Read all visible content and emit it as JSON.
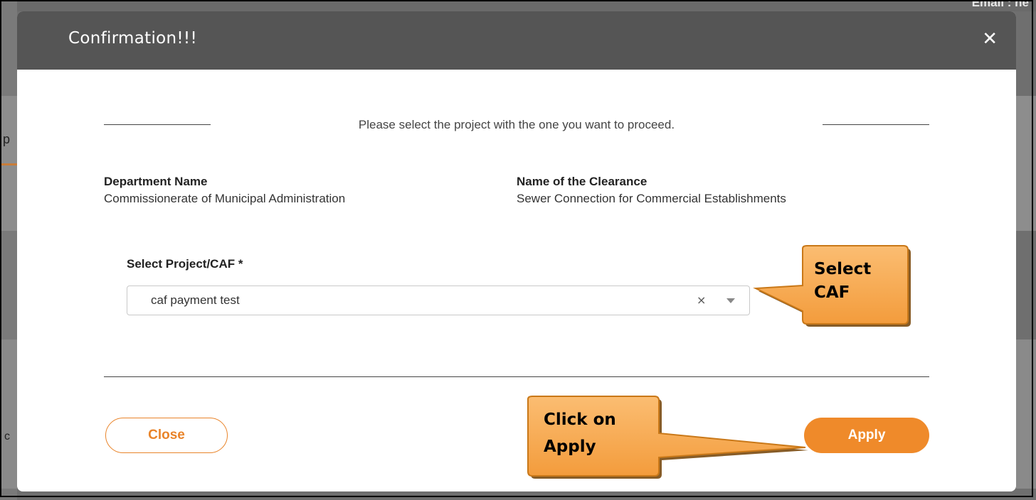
{
  "background": {
    "email_fragment": "Email : ne",
    "left_letter_top": "p",
    "left_letter_bottom": "c"
  },
  "modal": {
    "title": "Confirmation!!!",
    "close_icon": "close-icon",
    "instruction": "Please select the project with the one you want to proceed.",
    "department_label": "Department Name",
    "department_value": "Commissionerate of Municipal Administration",
    "clearance_label": "Name of the Clearance",
    "clearance_value": "Sewer Connection for Commercial Establishments",
    "select_label": "Select Project/CAF *",
    "select_value": "caf payment test",
    "select_clear": "×",
    "close_button": "Close",
    "apply_button": "Apply"
  },
  "annotations": {
    "select_caf_line1": "Select",
    "select_caf_line2": "CAF",
    "apply_line1": "Click on",
    "apply_line2": "Apply"
  },
  "colors": {
    "header": "#555555",
    "accent": "#ef8a2a",
    "callout_fill": "#f7a84f",
    "callout_border": "#c97818"
  }
}
